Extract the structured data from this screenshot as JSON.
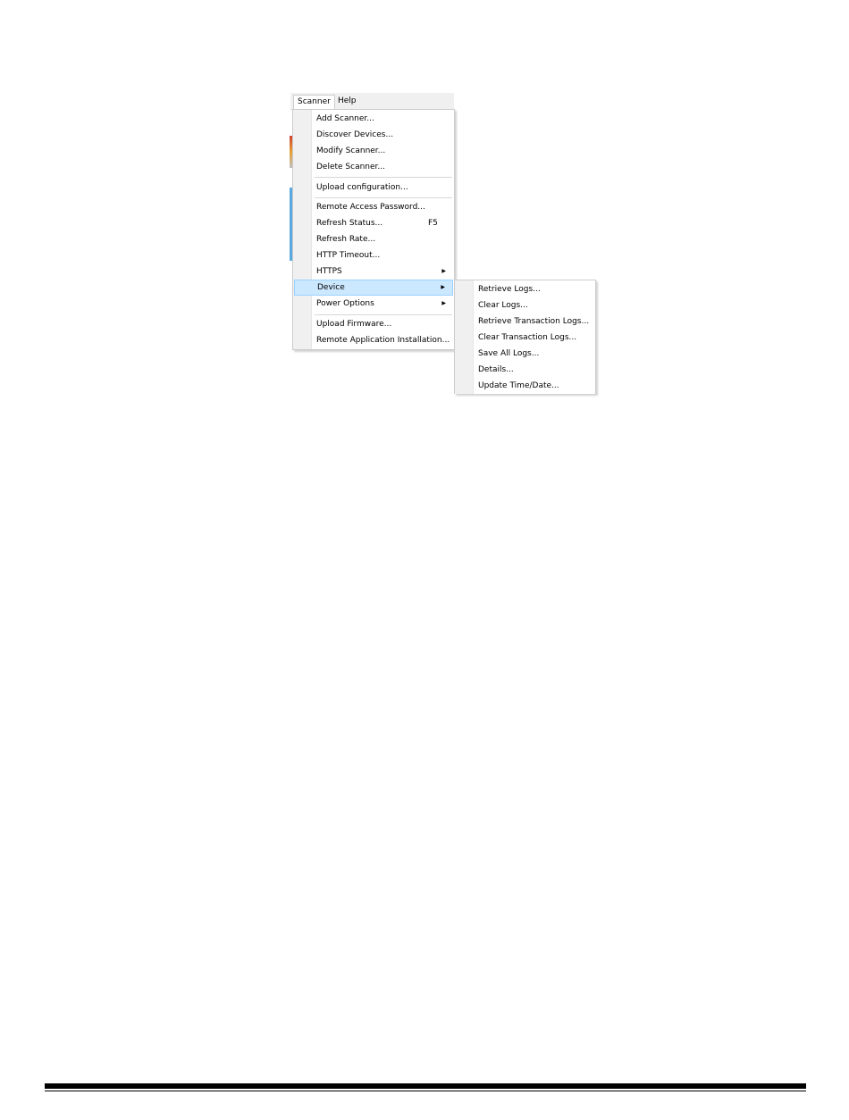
{
  "menubar": {
    "items": [
      {
        "label": "Scanner"
      },
      {
        "label": "Help"
      }
    ]
  },
  "scanner_menu": {
    "items": [
      {
        "label": "Add Scanner..."
      },
      {
        "label": "Discover Devices..."
      },
      {
        "label": "Modify Scanner..."
      },
      {
        "label": "Delete Scanner..."
      },
      {
        "label": "Upload configuration..."
      },
      {
        "label": "Remote Access Password..."
      },
      {
        "label": "Refresh Status...",
        "shortcut": "F5"
      },
      {
        "label": "Refresh Rate..."
      },
      {
        "label": "HTTP Timeout..."
      },
      {
        "label": "HTTPS",
        "submenu": true
      },
      {
        "label": "Device",
        "submenu": true,
        "highlighted": true
      },
      {
        "label": "Power Options",
        "submenu": true
      },
      {
        "label": "Upload Firmware..."
      },
      {
        "label": "Remote Application Installation..."
      }
    ],
    "submenu_arrow_icon": "triangle-right-icon"
  },
  "device_submenu": {
    "items": [
      {
        "label": "Retrieve Logs..."
      },
      {
        "label": "Clear Logs..."
      },
      {
        "label": "Retrieve Transaction Logs..."
      },
      {
        "label": "Clear Transaction Logs..."
      },
      {
        "label": "Save All Logs..."
      },
      {
        "label": "Details..."
      },
      {
        "label": "Update Time/Date..."
      }
    ]
  },
  "colors": {
    "highlight_fill": "#cce8ff",
    "highlight_border": "#99d1ff",
    "menu_border": "#cccccc",
    "gutter": "#f0f0f0"
  }
}
